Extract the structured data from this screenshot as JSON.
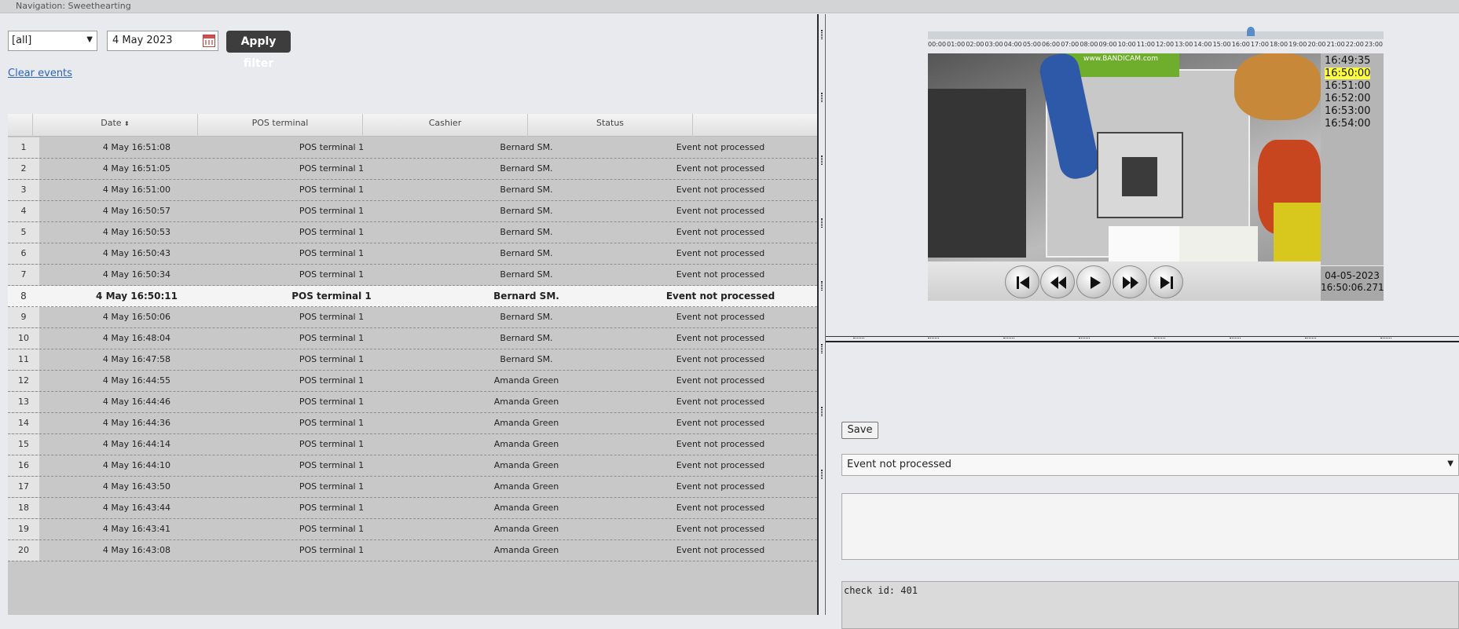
{
  "nav": {
    "title": "Navigation: Sweethearting"
  },
  "filter": {
    "select_value": "[all]",
    "date_value": "4 May 2023",
    "apply_label": "Apply filter",
    "clear_label": "Clear events"
  },
  "grid": {
    "columns": [
      "Date",
      "POS terminal",
      "Cashier",
      "Status"
    ],
    "selected_row": 8,
    "rows": [
      {
        "n": "1",
        "date": "4 May 16:51:08",
        "pos": "POS terminal 1",
        "cashier": "Bernard SM.",
        "status": "Event not processed"
      },
      {
        "n": "2",
        "date": "4 May 16:51:05",
        "pos": "POS terminal 1",
        "cashier": "Bernard SM.",
        "status": "Event not processed"
      },
      {
        "n": "3",
        "date": "4 May 16:51:00",
        "pos": "POS terminal 1",
        "cashier": "Bernard SM.",
        "status": "Event not processed"
      },
      {
        "n": "4",
        "date": "4 May 16:50:57",
        "pos": "POS terminal 1",
        "cashier": "Bernard SM.",
        "status": "Event not processed"
      },
      {
        "n": "5",
        "date": "4 May 16:50:53",
        "pos": "POS terminal 1",
        "cashier": "Bernard SM.",
        "status": "Event not processed"
      },
      {
        "n": "6",
        "date": "4 May 16:50:43",
        "pos": "POS terminal 1",
        "cashier": "Bernard SM.",
        "status": "Event not processed"
      },
      {
        "n": "7",
        "date": "4 May 16:50:34",
        "pos": "POS terminal 1",
        "cashier": "Bernard SM.",
        "status": "Event not processed"
      },
      {
        "n": "8",
        "date": "4 May 16:50:11",
        "pos": "POS terminal 1",
        "cashier": "Bernard SM.",
        "status": "Event not processed"
      },
      {
        "n": "9",
        "date": "4 May 16:50:06",
        "pos": "POS terminal 1",
        "cashier": "Bernard SM.",
        "status": "Event not processed"
      },
      {
        "n": "10",
        "date": "4 May 16:48:04",
        "pos": "POS terminal 1",
        "cashier": "Bernard SM.",
        "status": "Event not processed"
      },
      {
        "n": "11",
        "date": "4 May 16:47:58",
        "pos": "POS terminal 1",
        "cashier": "Bernard SM.",
        "status": "Event not processed"
      },
      {
        "n": "12",
        "date": "4 May 16:44:55",
        "pos": "POS terminal 1",
        "cashier": "Amanda Green",
        "status": "Event not processed"
      },
      {
        "n": "13",
        "date": "4 May 16:44:46",
        "pos": "POS terminal 1",
        "cashier": "Amanda Green",
        "status": "Event not processed"
      },
      {
        "n": "14",
        "date": "4 May 16:44:36",
        "pos": "POS terminal 1",
        "cashier": "Amanda Green",
        "status": "Event not processed"
      },
      {
        "n": "15",
        "date": "4 May 16:44:14",
        "pos": "POS terminal 1",
        "cashier": "Amanda Green",
        "status": "Event not processed"
      },
      {
        "n": "16",
        "date": "4 May 16:44:10",
        "pos": "POS terminal 1",
        "cashier": "Amanda Green",
        "status": "Event not processed"
      },
      {
        "n": "17",
        "date": "4 May 16:43:50",
        "pos": "POS terminal 1",
        "cashier": "Amanda Green",
        "status": "Event not processed"
      },
      {
        "n": "18",
        "date": "4 May 16:43:44",
        "pos": "POS terminal 1",
        "cashier": "Amanda Green",
        "status": "Event not processed"
      },
      {
        "n": "19",
        "date": "4 May 16:43:41",
        "pos": "POS terminal 1",
        "cashier": "Amanda Green",
        "status": "Event not processed"
      },
      {
        "n": "20",
        "date": "4 May 16:43:08",
        "pos": "POS terminal 1",
        "cashier": "Amanda Green",
        "status": "Event not processed"
      }
    ]
  },
  "player": {
    "timeline_ticks": [
      "00:00",
      "01:00",
      "02:00",
      "03:00",
      "04:00",
      "05:00",
      "06:00",
      "07:00",
      "08:00",
      "09:00",
      "10:00",
      "11:00",
      "12:00",
      "13:00",
      "14:00",
      "15:00",
      "16:00",
      "17:00",
      "18:00",
      "19:00",
      "20:00",
      "21:00",
      "22:00",
      "23:00"
    ],
    "watermark": "www.BANDICAM.com",
    "times": [
      "16:49:35",
      "16:50:00",
      "16:51:00",
      "16:52:00",
      "16:53:00",
      "16:54:00"
    ],
    "highlighted_time_index": 1,
    "stamp_date": "04-05-2023",
    "stamp_time": "16:50:06.271",
    "highlight_color": "#ffff3c",
    "controls": [
      "skip-back-icon",
      "rewind-icon",
      "play-icon",
      "fast-forward-icon",
      "skip-forward-icon"
    ]
  },
  "details": {
    "save_label": "Save",
    "status_value": "Event not processed",
    "check_text": "check id: 401"
  }
}
